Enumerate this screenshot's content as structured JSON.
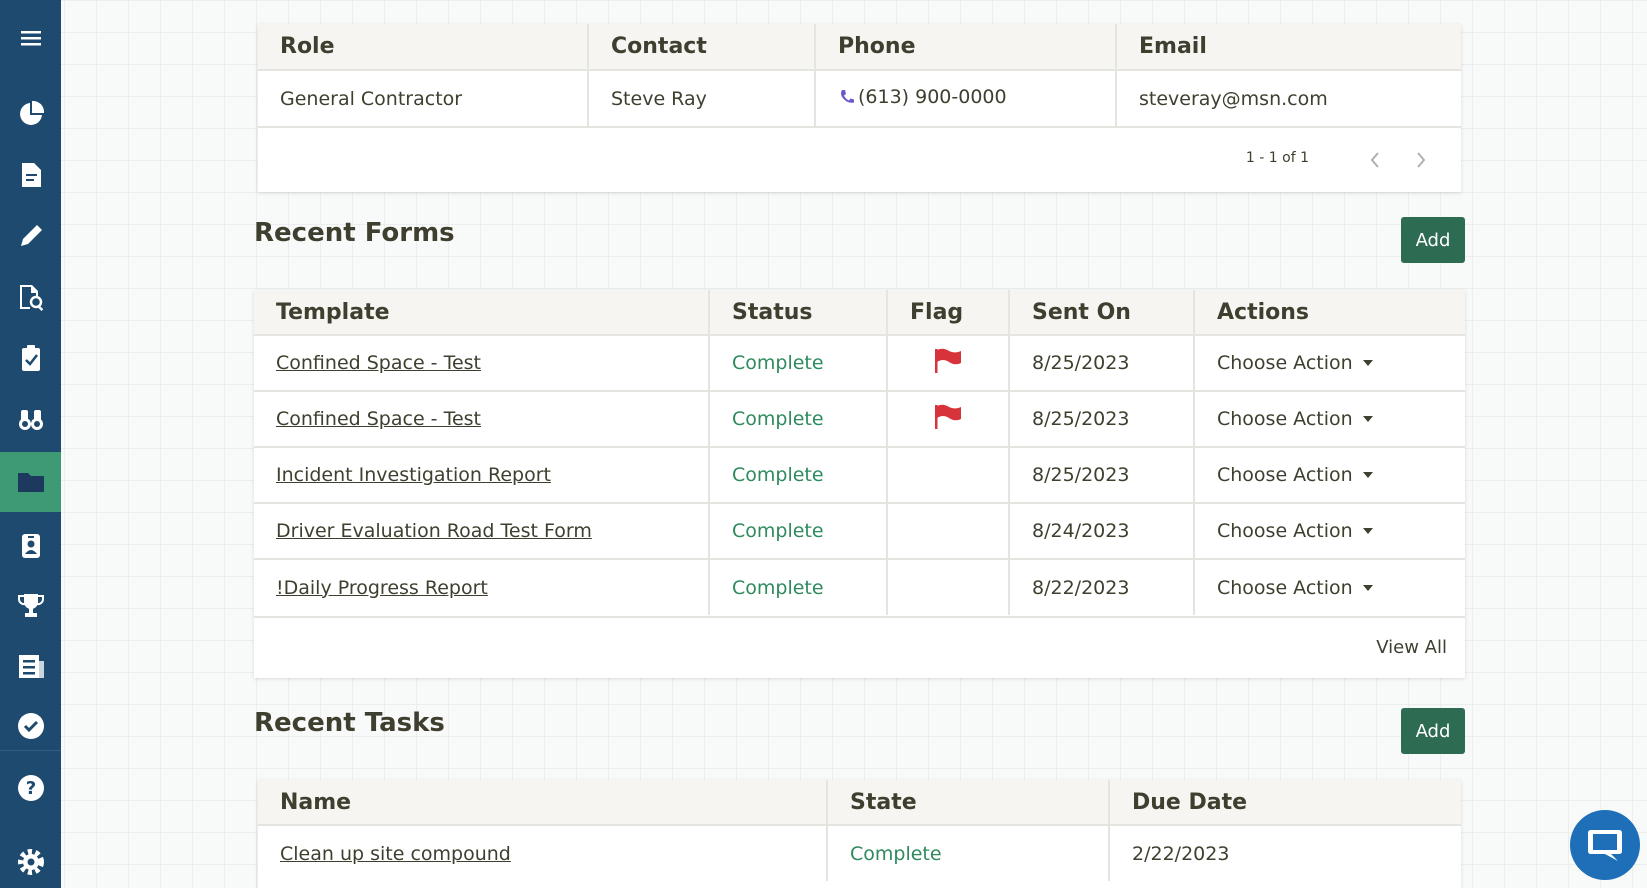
{
  "sidebar": {
    "items": [
      {
        "icon": "menu-icon"
      },
      {
        "icon": "pie-chart-icon"
      },
      {
        "icon": "document-icon"
      },
      {
        "icon": "pencil-icon"
      },
      {
        "icon": "search-document-icon"
      },
      {
        "icon": "clipboard-check-icon"
      },
      {
        "icon": "binoculars-icon"
      },
      {
        "icon": "folder-icon",
        "active": true
      },
      {
        "icon": "id-badge-icon"
      },
      {
        "icon": "trophy-icon"
      },
      {
        "icon": "newspaper-icon"
      },
      {
        "icon": "check-circle-icon"
      },
      {
        "icon": "help-icon"
      },
      {
        "icon": "gear-icon"
      }
    ],
    "colors": {
      "background": "#1d4a6e",
      "active": "#3e9a74"
    }
  },
  "contacts": {
    "columns": [
      "Role",
      "Contact",
      "Phone",
      "Email"
    ],
    "rows": [
      {
        "role": "General Contractor",
        "contact": "Steve Ray",
        "phone": "(613) 900-0000",
        "email": "steveray@msn.com"
      }
    ],
    "pagination": "1 - 1 of 1"
  },
  "recent_forms": {
    "title": "Recent Forms",
    "add_label": "Add",
    "columns": [
      "Template",
      "Status",
      "Flag",
      "Sent On",
      "Actions"
    ],
    "rows": [
      {
        "template": "Confined Space - Test",
        "status": "Complete",
        "flagged": true,
        "sent_on": "8/25/2023",
        "action": "Choose Action"
      },
      {
        "template": "Confined Space - Test",
        "status": "Complete",
        "flagged": true,
        "sent_on": "8/25/2023",
        "action": "Choose Action"
      },
      {
        "template": "Incident Investigation Report",
        "status": "Complete",
        "flagged": false,
        "sent_on": "8/25/2023",
        "action": "Choose Action"
      },
      {
        "template": "Driver Evaluation Road Test Form",
        "status": "Complete",
        "flagged": false,
        "sent_on": "8/24/2023",
        "action": "Choose Action"
      },
      {
        "template": "!Daily Progress Report",
        "status": "Complete",
        "flagged": false,
        "sent_on": "8/22/2023",
        "action": "Choose Action"
      }
    ],
    "view_all": "View All"
  },
  "recent_tasks": {
    "title": "Recent Tasks",
    "add_label": "Add",
    "columns": [
      "Name",
      "State",
      "Due Date"
    ],
    "rows": [
      {
        "name": "Clean up site compound",
        "state": "Complete",
        "due": "2/22/2023"
      }
    ]
  },
  "colors": {
    "accent": "#2d6b52",
    "status": "#2f8a5d",
    "flag": "#d6333b",
    "chat": "#1f6fb8"
  }
}
